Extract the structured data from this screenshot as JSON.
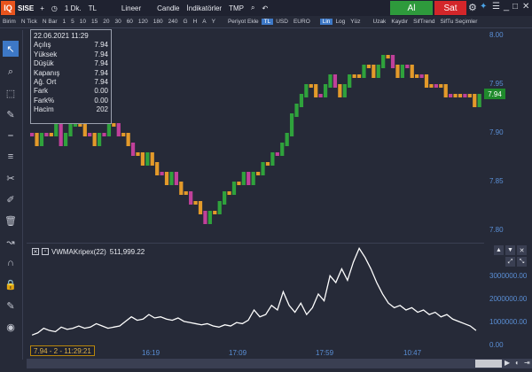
{
  "toolbar": {
    "logo": "IQ",
    "symbol": "SISE",
    "plus": "+",
    "period": "1 Dk.",
    "currency": "TL",
    "chart_style": "Lineer",
    "candle": "Candle",
    "indicators": "İndikatörler",
    "template": "TMP",
    "buy": "Al",
    "sell": "Sat"
  },
  "toolbar2": {
    "items": [
      "Birim",
      "N Tick",
      "N Bar",
      "1",
      "5",
      "10",
      "15",
      "20",
      "30",
      "60",
      "120",
      "180",
      "240",
      "G",
      "H",
      "A",
      "Y",
      "Periyot Ekle",
      "TL",
      "USD",
      "EURO",
      "Lin",
      "Log",
      "Yüz",
      "Uzak",
      "Kaydır",
      "SifTrend",
      "SifTu Seçimler"
    ],
    "active": [
      "TL",
      "Lin"
    ]
  },
  "info": {
    "datetime": "22.06.2021 11:29",
    "rows": [
      {
        "label": "Açılış",
        "value": "7.94"
      },
      {
        "label": "Yüksek",
        "value": "7.94"
      },
      {
        "label": "Düşük",
        "value": "7.94"
      },
      {
        "label": "Kapanış",
        "value": "7.94"
      },
      {
        "label": "Ağ. Ort",
        "value": "7.94"
      },
      {
        "label": "Fark",
        "value": "0.00"
      },
      {
        "label": "Fark%",
        "value": "0.00"
      },
      {
        "label": "Hacim",
        "value": "202"
      }
    ]
  },
  "main_axis": {
    "ticks": [
      "8.00",
      "7.95",
      "7.90",
      "7.85",
      "7.80"
    ],
    "last_price": "7.94"
  },
  "indicator": {
    "label": "VWMAKripex(22)",
    "value": "511,999.22",
    "ticks": [
      "3000000.00",
      "2000000.00",
      "1000000.00",
      "0.00"
    ]
  },
  "time_axis": {
    "labels": [
      "16:19",
      "17:09",
      "17:59",
      "10:47"
    ],
    "cursor": "7.94 - 2 - 11:29:21"
  },
  "colors": {
    "up": "#e39a2a",
    "down": "#c0409a",
    "green": "#2fa23c",
    "line": "#ffffff"
  },
  "chart_data": [
    {
      "type": "bar",
      "y_range": [
        7.8,
        8.0
      ],
      "ticks": [
        8.0,
        7.95,
        7.9,
        7.85,
        7.8
      ],
      "last_value": 7.94,
      "values": [
        7.9,
        7.89,
        7.9,
        7.9,
        7.9,
        7.91,
        7.89,
        7.9,
        7.91,
        7.92,
        7.91,
        7.9,
        7.9,
        7.89,
        7.9,
        7.9,
        7.91,
        7.91,
        7.9,
        7.9,
        7.89,
        7.88,
        7.88,
        7.87,
        7.88,
        7.87,
        7.86,
        7.86,
        7.85,
        7.86,
        7.85,
        7.84,
        7.84,
        7.83,
        7.83,
        7.82,
        7.81,
        7.82,
        7.82,
        7.83,
        7.84,
        7.84,
        7.85,
        7.85,
        7.86,
        7.85,
        7.86,
        7.86,
        7.87,
        7.87,
        7.88,
        7.88,
        7.89,
        7.9,
        7.92,
        7.93,
        7.94,
        7.95,
        7.95,
        7.94,
        7.94,
        7.95,
        7.96,
        7.95,
        7.94,
        7.95,
        7.96,
        7.96,
        7.96,
        7.97,
        7.97,
        7.96,
        7.97,
        7.98,
        7.98,
        7.97,
        7.96,
        7.97,
        7.97,
        7.96,
        7.96,
        7.96,
        7.95,
        7.95,
        7.95,
        7.95,
        7.94,
        7.94,
        7.94,
        7.94,
        7.94,
        7.94,
        7.93,
        7.94
      ]
    },
    {
      "type": "line",
      "y_range": [
        0,
        4000000
      ],
      "ticks": [
        3000000,
        2000000,
        1000000,
        0
      ],
      "last_value": 511999.22,
      "values": [
        300000,
        400000,
        600000,
        500000,
        450000,
        650000,
        550000,
        600000,
        700000,
        600000,
        650000,
        800000,
        700000,
        600000,
        650000,
        700000,
        900000,
        1100000,
        950000,
        1000000,
        1200000,
        1050000,
        1100000,
        1000000,
        950000,
        1050000,
        900000,
        850000,
        800000,
        750000,
        800000,
        700000,
        650000,
        750000,
        700000,
        850000,
        800000,
        950000,
        1400000,
        1100000,
        1200000,
        1600000,
        1400000,
        2200000,
        1600000,
        1300000,
        1700000,
        1200000,
        1500000,
        2100000,
        1800000,
        2900000,
        2600000,
        3200000,
        2700000,
        3500000,
        4100000,
        3700000,
        3200000,
        2600000,
        2100000,
        1700000,
        1500000,
        1600000,
        1400000,
        1500000,
        1300000,
        1400000,
        1200000,
        1300000,
        1100000,
        1200000,
        1000000,
        900000,
        800000,
        700000,
        500000
      ]
    }
  ]
}
